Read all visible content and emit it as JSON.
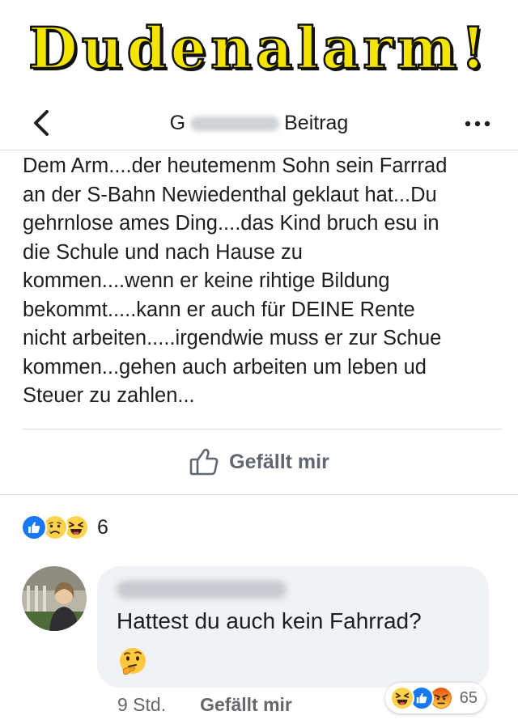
{
  "banner": {
    "text": "Dudenalarm!"
  },
  "header": {
    "title_prefix": "G",
    "title_suffix": "Beitrag",
    "back_icon": "chevron-left-icon",
    "more_icon": "more-dots-icon"
  },
  "post": {
    "lines": [
      "Dem Arm....der heutemenm Sohn sein Farrrad",
      "an der S-Bahn Newiedenthal geklaut hat...Du",
      "gehrnlose ames Ding....das Kind bruch esu in",
      "die Schule und nach Hause zu",
      "kommen....wenn er keine rihtige Bildung",
      "bekommt.....kann er auch für DEINE Rente",
      "nicht arbeiten.....irgendwie muss er zur Schue",
      "kommen...gehen auch arbeiten um leben ud",
      "Steuer zu zahlen..."
    ]
  },
  "like_button": {
    "label": "Gefällt mir",
    "icon": "thumbs-up-outline-icon"
  },
  "reactions": {
    "icons": [
      "like",
      "sad",
      "haha"
    ],
    "count": "6"
  },
  "comment": {
    "text": "Hattest du auch kein Fahrrad?",
    "emoji": "thinking-face",
    "time": "9 Std.",
    "like_label": "Gefällt mir",
    "reaction_icons": [
      "haha",
      "like",
      "angry"
    ],
    "reaction_count": "65"
  },
  "colors": {
    "banner_fill": "#f3e500",
    "like_blue": "#1877f2",
    "emoji_yellow": "#fcd34d",
    "angry_red": "#e9710f"
  }
}
